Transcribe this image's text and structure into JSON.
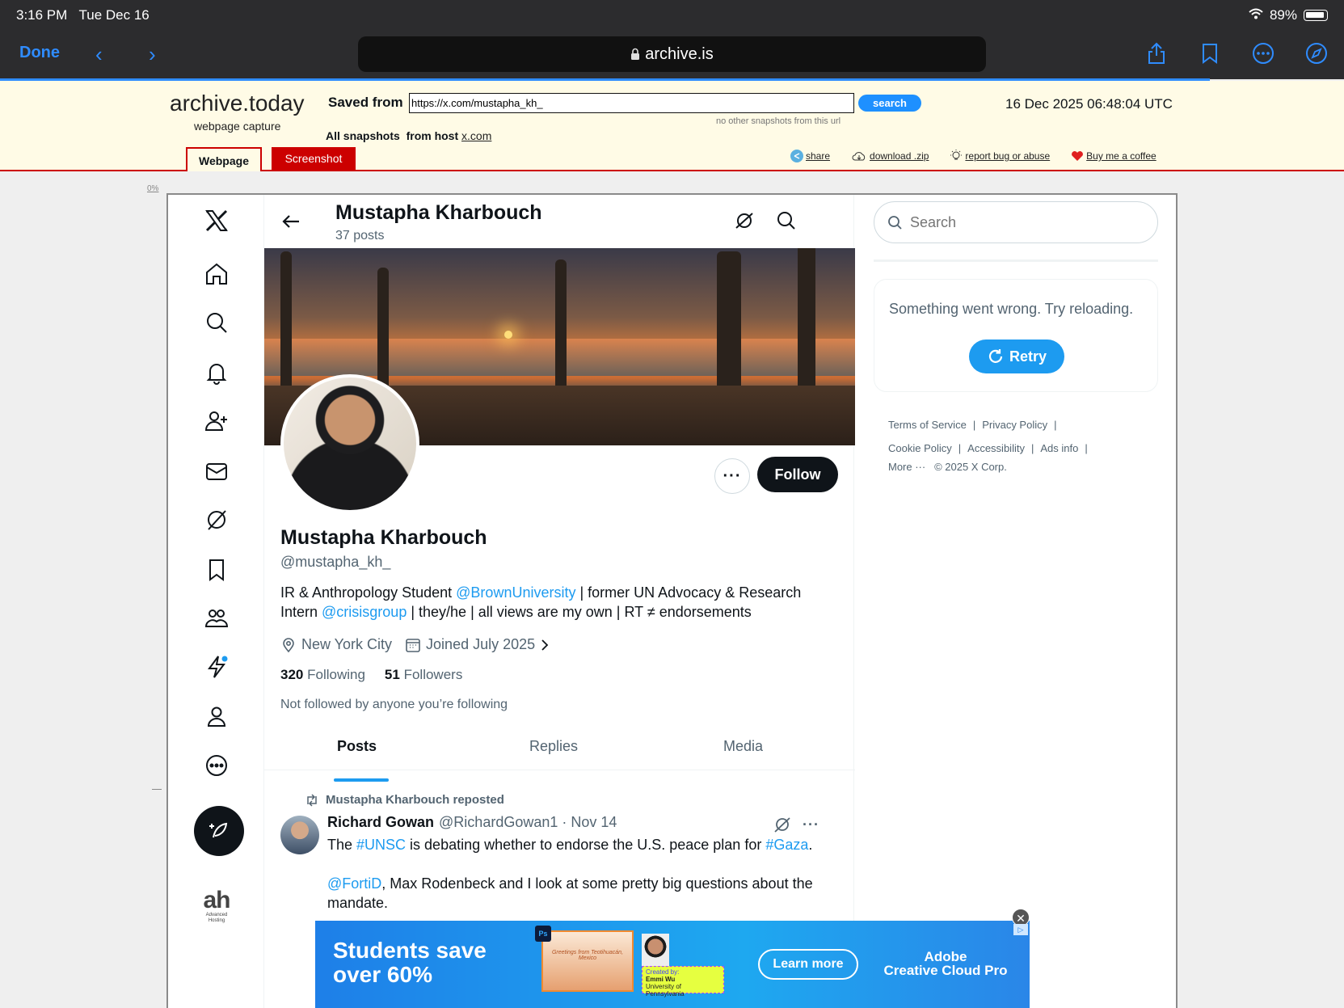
{
  "status": {
    "time": "3:16 PM",
    "day": "Tue Dec 16",
    "battery": "89%"
  },
  "safari": {
    "done_label": "Done",
    "url": "archive.is",
    "icons": [
      "share-icon",
      "bookmarks-icon",
      "more-icon",
      "compass-icon"
    ]
  },
  "archive": {
    "title": "archive.today",
    "subtitle": "webpage capture",
    "saved_from_label": "Saved from",
    "url_value": "https://x.com/mustapha_kh_",
    "search_label": "search",
    "no_snapshots": "no other snapshots from this url",
    "capture_date": "16 Dec 2025 06:48:04 UTC",
    "all_snapshots_label": "All snapshots",
    "from_host_label": "from host",
    "host": "x.com",
    "tab_webpage": "Webpage",
    "tab_screenshot": "Screenshot",
    "links": {
      "share": "share",
      "download": "download .zip",
      "report": "report bug or abuse",
      "coffee": "Buy me a coffee"
    },
    "progress": "0%",
    "accent_color": "#cc0000"
  },
  "profile": {
    "header_name": "Mustapha Kharbouch",
    "post_count": "37 posts",
    "name": "Mustapha Kharbouch",
    "handle": "@mustapha_kh_",
    "follow_label": "Follow",
    "more_label": "···",
    "bio": {
      "part1": "IR & Anthropology Student ",
      "mention1": "@BrownUniversity",
      "part2": " | former UN Advocacy & Research Intern ",
      "mention2": "@crisisgroup",
      "part3": " | they/he | all views are my own | RT ≠ endorsements"
    },
    "location": "New York City",
    "joined": "Joined July 2025",
    "following_count": "320",
    "following_label": "Following",
    "followers_count": "51",
    "followers_label": "Followers",
    "not_followed": "Not followed by anyone you’re following"
  },
  "tabs": [
    {
      "label": "Posts"
    },
    {
      "label": "Replies"
    },
    {
      "label": "Media"
    }
  ],
  "tweet": {
    "repost_line": "Mustapha Kharbouch reposted",
    "author": "Richard Gowan",
    "handle_date": "@RichardGowan1 · Nov 14",
    "text1_a": "The ",
    "tag1": "#UNSC",
    "text1_b": " is debating whether to endorse the U.S. peace plan for ",
    "tag2": "#Gaza",
    "text1_c": ".",
    "mention": "@FortiD",
    "text2": ", Max Rodenbeck and I look at some pretty big questions about the mandate.",
    "more_label": "···"
  },
  "sidebar": {
    "search_placeholder": "Search",
    "error_message": "Something went wrong. Try reloading.",
    "retry_label": "Retry",
    "footer": [
      "Terms of Service",
      "Privacy Policy",
      "Cookie Policy",
      "Accessibility",
      "Ads info",
      "More ···",
      "© 2025 X Corp."
    ]
  },
  "left_nav_icons": [
    "x-logo-icon",
    "home-icon",
    "explore-icon",
    "notifications-icon",
    "follow-icon",
    "messages-icon",
    "grok-icon",
    "bookmarks-icon",
    "communities-icon",
    "premium-icon",
    "profile-icon",
    "more-icon"
  ],
  "ah_logo": {
    "big": "ah",
    "small": "Advanced Hosting"
  },
  "ad": {
    "headline_line1": "Students save",
    "headline_line2": "over 60%",
    "learn_more": "Learn more",
    "brand_line1": "Adobe",
    "brand_line2": "Creative Cloud Pro",
    "image_badge": "Ps",
    "image_caption": "Greetings from Teotihuacán, Mexico",
    "created_by": "Created by:",
    "creator_name": "Emmi Wu",
    "creator_school": "University of Pennsylvania",
    "close_label": "✕"
  },
  "colors": {
    "link_blue": "#1d9bf0",
    "safari_blue": "#2f8cff",
    "archive_bg": "#fffbe6"
  }
}
